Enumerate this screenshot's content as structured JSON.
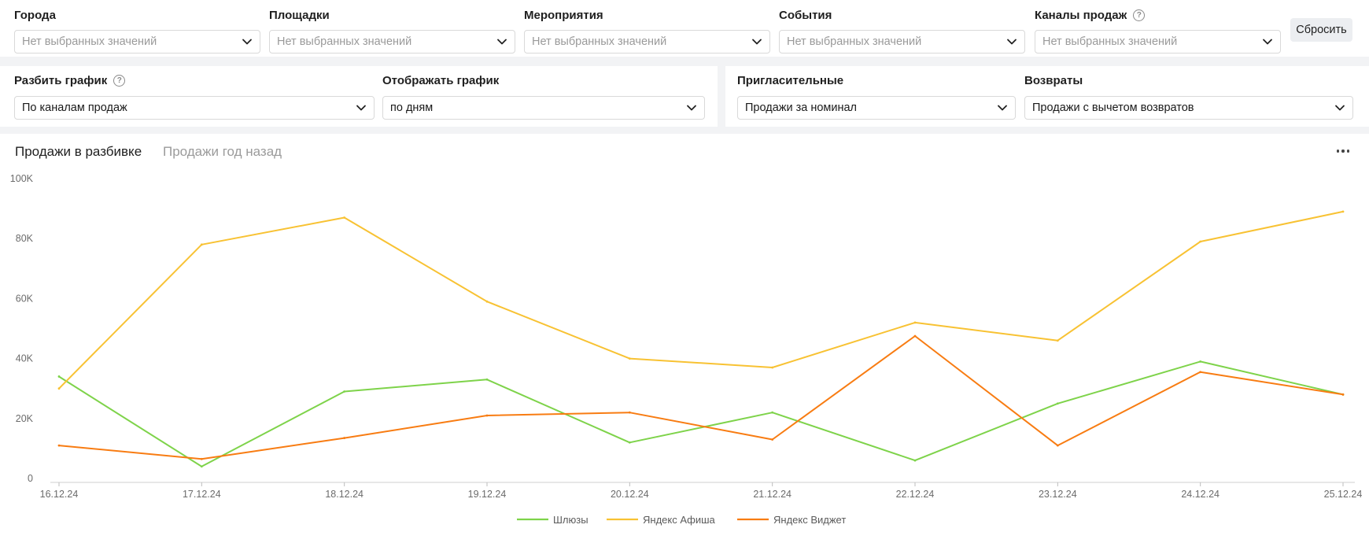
{
  "filters": [
    {
      "label": "Города",
      "value": "Нет выбранных значений",
      "placeholder": true,
      "help": false
    },
    {
      "label": "Площадки",
      "value": "Нет выбранных значений",
      "placeholder": true,
      "help": false
    },
    {
      "label": "Мероприятия",
      "value": "Нет выбранных значений",
      "placeholder": true,
      "help": false
    },
    {
      "label": "События",
      "value": "Нет выбранных значений",
      "placeholder": true,
      "help": false
    },
    {
      "label": "Каналы продаж",
      "value": "Нет выбранных значений",
      "placeholder": true,
      "help": true
    }
  ],
  "reset_label": "Сбросить",
  "options_left": [
    {
      "label": "Разбить график",
      "value": "По каналам продаж",
      "help": true
    },
    {
      "label": "Отображать график",
      "value": "по дням",
      "help": false
    }
  ],
  "options_right": [
    {
      "label": "Пригласительные",
      "value": "Продажи за номинал",
      "help": false
    },
    {
      "label": "Возвраты",
      "value": "Продажи с вычетом возвратов",
      "help": false
    }
  ],
  "help_glyph": "?",
  "tabs": {
    "active": "Продажи в разбивке",
    "inactive": "Продажи год назад"
  },
  "icons": {
    "dropdown": "chevron-down-icon",
    "help": "help-circle-icon",
    "more": "more-horizontal-icon"
  },
  "chart_data": {
    "type": "line",
    "x": [
      "16.12.24",
      "17.12.24",
      "18.12.24",
      "19.12.24",
      "20.12.24",
      "21.12.24",
      "22.12.24",
      "23.12.24",
      "24.12.24",
      "25.12.24"
    ],
    "ylim": [
      0,
      100000
    ],
    "yticks": [
      0,
      20000,
      40000,
      60000,
      80000,
      100000
    ],
    "ytick_labels": [
      "0",
      "20K",
      "40K",
      "60K",
      "80K",
      "100K"
    ],
    "grid": false,
    "legend_position": "bottom",
    "series": [
      {
        "name": "Шлюзы",
        "color": "#7ed34a",
        "values": [
          34000,
          4000,
          29000,
          33000,
          12000,
          22000,
          6000,
          25000,
          39000,
          28000
        ]
      },
      {
        "name": "Яндекс Афиша",
        "color": "#f8c233",
        "values": [
          30000,
          78000,
          87000,
          59000,
          40000,
          37000,
          52000,
          46000,
          79000,
          89000
        ]
      },
      {
        "name": "Яндекс Виджет",
        "color": "#f87c12",
        "values": [
          11000,
          6500,
          13500,
          21000,
          22000,
          13000,
          47500,
          11000,
          35500,
          28000
        ]
      }
    ]
  }
}
